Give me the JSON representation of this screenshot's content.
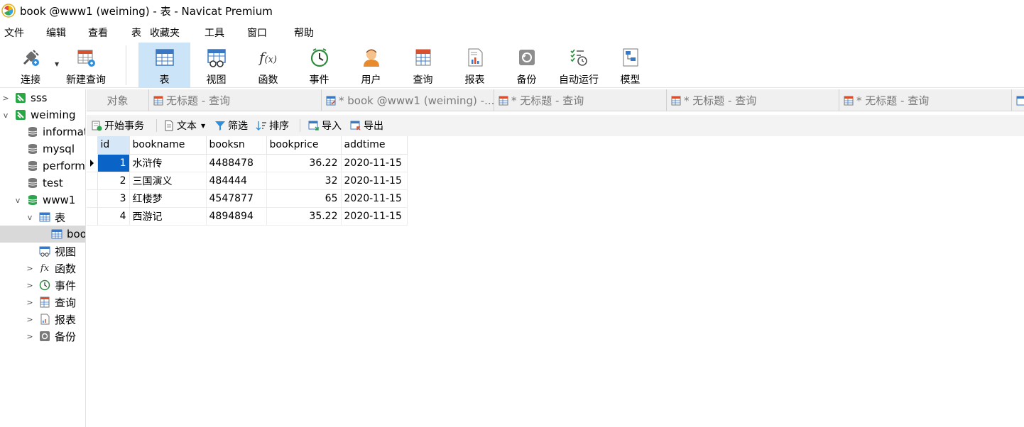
{
  "window": {
    "title": "book @www1 (weiming) - 表 - Navicat Premium"
  },
  "menu": [
    "文件",
    "编辑",
    "查看",
    "表",
    "收藏夹",
    "工具",
    "窗口",
    "帮助"
  ],
  "toolbar": {
    "connect": "连接",
    "new_query": "新建查询",
    "table": "表",
    "view": "视图",
    "function": "函数",
    "event": "事件",
    "user": "用户",
    "query": "查询",
    "report": "报表",
    "backup": "备份",
    "automation": "自动运行",
    "model": "模型"
  },
  "sidebar": {
    "conn_sss": "sss",
    "conn_weiming": "weiming",
    "db_information": "informat",
    "db_mysql": "mysql",
    "db_performance": "perform",
    "db_test": "test",
    "db_www1": "www1",
    "node_tables": "表",
    "table_book": "boo",
    "node_views": "视图",
    "node_functions": "函数",
    "node_events": "事件",
    "node_queries": "查询",
    "node_reports": "报表",
    "node_backups": "备份"
  },
  "tabs": {
    "objects": "对象",
    "t1": "无标题 - 查询",
    "t2": "* book @www1 (weiming) -...",
    "t3": "* 无标题 - 查询",
    "t4": "* 无标题 - 查询",
    "t5": "* 无标题 - 查询"
  },
  "subtoolbar": {
    "begin_transaction": "开始事务",
    "text": "文本",
    "filter": "筛选",
    "sort": "排序",
    "import": "导入",
    "export": "导出"
  },
  "grid": {
    "columns": [
      "id",
      "bookname",
      "booksn",
      "bookprice",
      "addtime"
    ],
    "rows": [
      [
        "1",
        "水浒传",
        "4488478",
        "36.22",
        "2020-11-15"
      ],
      [
        "2",
        "三国演义",
        "484444",
        "32",
        "2020-11-15"
      ],
      [
        "3",
        "红楼梦",
        "4547877",
        "65",
        "2020-11-15"
      ],
      [
        "4",
        "西游记",
        "4894894",
        "35.22",
        "2020-11-15"
      ]
    ]
  },
  "colors": {
    "selected_tab": "#cce4f7",
    "selected_cell": "#0a64c8",
    "header_highlight": "#d6e8f8"
  }
}
